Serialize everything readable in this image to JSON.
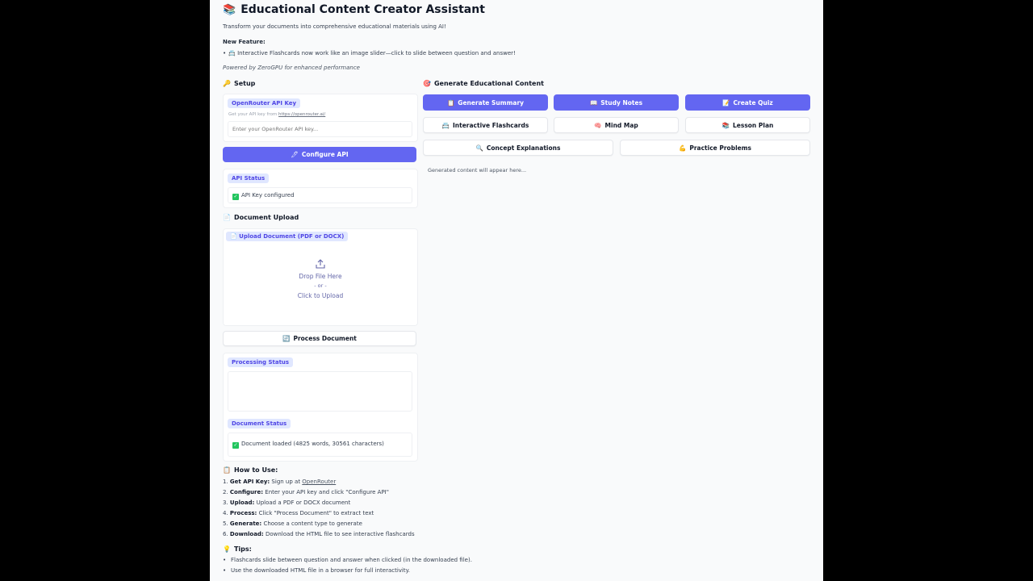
{
  "header": {
    "title_icon": "📚",
    "title": "Educational Content Creator Assistant",
    "subtitle": "Transform your documents into comprehensive educational materials using AI!",
    "new_feature_heading": "New Feature:",
    "new_feature_icon": "📇",
    "new_feature_text": "Interactive Flashcards now work like an image slider—click to slide between question and answer!",
    "powered_by": "Powered by ZeroGPU for enhanced performance"
  },
  "setup": {
    "heading_icon": "🔑",
    "heading": "Setup",
    "api_key_label": "OpenRouter API Key",
    "api_key_hint_prefix": "Get your API key from",
    "api_key_hint_link": "https://openrouter.ai/",
    "api_key_value": "",
    "api_key_placeholder": "Enter your OpenRouter API key...",
    "configure_icon": "🖊",
    "configure_label": "Configure API",
    "status_label": "API Status",
    "status_text": "API Key configured"
  },
  "upload": {
    "heading_icon": "📄",
    "heading": "Document Upload",
    "file_label_icon": "📄",
    "file_label": "Upload Document (PDF or DOCX)",
    "drop_line1": "Drop File Here",
    "drop_line2": "- or -",
    "drop_line3": "Click to Upload",
    "process_icon": "🔄",
    "process_label": "Process Document",
    "processing_status_label": "Processing Status",
    "processing_status_text": "",
    "document_status_label": "Document Status",
    "document_status_text": "Document loaded (4825 words, 30561 characters)"
  },
  "howto": {
    "heading_icon": "📋",
    "heading": "How to Use:",
    "steps": [
      {
        "num": "1.",
        "bold": "Get API Key:",
        "text": " Sign up at ",
        "link": "OpenRouter"
      },
      {
        "num": "2.",
        "bold": "Configure:",
        "text": " Enter your API key and click \"Configure API\"",
        "link": ""
      },
      {
        "num": "3.",
        "bold": "Upload:",
        "text": " Upload a PDF or DOCX document",
        "link": ""
      },
      {
        "num": "4.",
        "bold": "Process:",
        "text": " Click \"Process Document\" to extract text",
        "link": ""
      },
      {
        "num": "5.",
        "bold": "Generate:",
        "text": " Choose a content type to generate",
        "link": ""
      },
      {
        "num": "6.",
        "bold": "Download:",
        "text": " Download the HTML file to see interactive flashcards",
        "link": ""
      }
    ]
  },
  "tips": {
    "heading_icon": "💡",
    "heading": "Tips:",
    "items": [
      "Flashcards slide between question and answer when clicked (in the downloaded file).",
      "Use the downloaded HTML file in a browser for full interactivity."
    ]
  },
  "generate": {
    "heading_icon": "🎯",
    "heading": "Generate Educational Content",
    "buttons": [
      {
        "icon": "📋",
        "label": "Generate Summary"
      },
      {
        "icon": "📖",
        "label": "Study Notes"
      },
      {
        "icon": "📝",
        "label": "Create Quiz"
      },
      {
        "icon": "📇",
        "label": "Interactive Flashcards"
      },
      {
        "icon": "🧠",
        "label": "Mind Map"
      },
      {
        "icon": "📚",
        "label": "Lesson Plan"
      },
      {
        "icon": "🔍",
        "label": "Concept Explanations"
      },
      {
        "icon": "💪",
        "label": "Practice Problems"
      }
    ],
    "output_placeholder": "Generated content will appear here..."
  },
  "colors": {
    "primary": "#6366f1",
    "chip_bg": "#e0e7ff",
    "chip_text": "#4f46e5",
    "success": "#22c55e"
  }
}
